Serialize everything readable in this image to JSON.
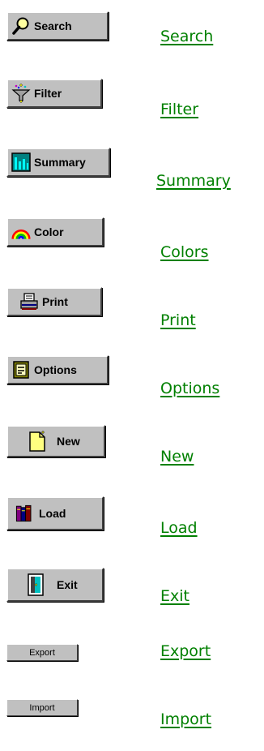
{
  "buttons": [
    {
      "label": "Search",
      "icon": "magnifier-icon"
    },
    {
      "label": "Filter",
      "icon": "funnel-icon"
    },
    {
      "label": "Summary",
      "icon": "bar-chart-icon"
    },
    {
      "label": "Color",
      "icon": "rainbow-icon"
    },
    {
      "label": "Print",
      "icon": "printer-icon"
    },
    {
      "label": "Options",
      "icon": "options-icon"
    },
    {
      "label": "New",
      "icon": "new-document-icon"
    },
    {
      "label": "Load",
      "icon": "books-icon"
    },
    {
      "label": "Exit",
      "icon": "door-icon"
    },
    {
      "label": "Export"
    },
    {
      "label": "Import"
    }
  ],
  "links": [
    "Search",
    "Filter",
    "Summary",
    "Colors",
    "Print",
    "Options",
    "New",
    "Load",
    "Exit",
    "Export",
    "Import"
  ],
  "colors": {
    "link": "#008000",
    "button_face": "#c0c0c0"
  }
}
